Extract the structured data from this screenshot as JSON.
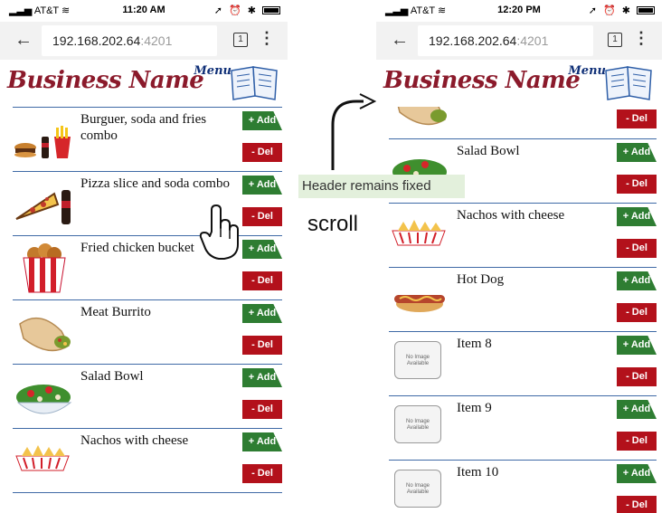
{
  "left": {
    "status": {
      "carrier": "AT&T",
      "time": "11:20 AM"
    },
    "browser": {
      "host": "192.168.202.64",
      "port": ":4201",
      "tabs": "1"
    },
    "header": {
      "brand": "Business Name",
      "menu": "Menu"
    },
    "items": [
      {
        "name": "Burguer, soda and fries combo",
        "icon": "burger-combo-icon"
      },
      {
        "name": "Pizza slice and soda combo",
        "icon": "pizza-combo-icon"
      },
      {
        "name": "Fried chicken bucket",
        "icon": "chicken-bucket-icon"
      },
      {
        "name": "Meat Burrito",
        "icon": "burrito-icon"
      },
      {
        "name": "Salad Bowl",
        "icon": "salad-icon"
      },
      {
        "name": "Nachos with cheese",
        "icon": "nachos-icon"
      }
    ]
  },
  "right": {
    "status": {
      "carrier": "AT&T",
      "time": "12:20 PM"
    },
    "browser": {
      "host": "192.168.202.64",
      "port": ":4201",
      "tabs": "1"
    },
    "header": {
      "brand": "Business Name",
      "menu": "Menu"
    },
    "items": [
      {
        "name": "",
        "icon": "burrito-icon"
      },
      {
        "name": "Salad Bowl",
        "icon": "salad-icon"
      },
      {
        "name": "Nachos with cheese",
        "icon": "nachos-icon"
      },
      {
        "name": "Hot Dog",
        "icon": "hotdog-icon"
      },
      {
        "name": "Item 8",
        "icon": "no-image-icon"
      },
      {
        "name": "Item 9",
        "icon": "no-image-icon"
      },
      {
        "name": "Item 10",
        "icon": "no-image-icon"
      }
    ]
  },
  "buttons": {
    "add": "+ Add",
    "del": "- Del"
  },
  "no_image_text": "No Image Available",
  "annotations": {
    "header_fixed": "Header remains fixed",
    "scroll": "scroll"
  },
  "colors": {
    "brand": "#8b1a2b",
    "add": "#2e7d32",
    "del": "#b3111b",
    "divider": "#3f6aa6"
  }
}
